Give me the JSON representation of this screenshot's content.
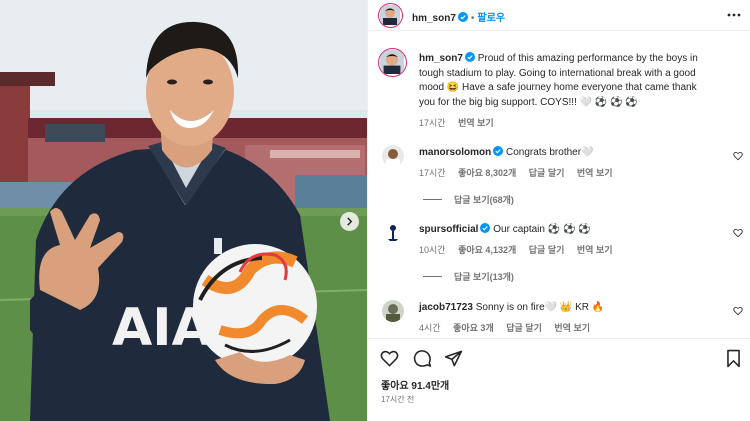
{
  "post": {
    "author": "hm_son7",
    "follow_label": "팔로우",
    "caption_lines": [
      "Proud of this amazing performance by the boys in",
      "tough stadium to play. Going to international break with a good",
      "mood 😆  Have a safe journey home everyone that came thank",
      "you for the big big support. COYS!!! 🤍 ⚽ ⚽ ⚽"
    ],
    "caption_time": "17시간",
    "translate_label": "번역 보기",
    "likes": "좋아요 91.4만개",
    "time": "17시간 전"
  },
  "comments": [
    {
      "user": "manorsolomon",
      "verified": true,
      "text": "Congrats brother🤍",
      "time": "17시간",
      "likes": "좋아요 8,302개",
      "reply_label": "답글 달기",
      "translate_label": "번역 보기",
      "replies": "답글 보기(68개)"
    },
    {
      "user": "spursofficial",
      "verified": true,
      "text": "Our captain ⚽ ⚽ ⚽",
      "time": "10시간",
      "likes": "좋아요 4,132개",
      "reply_label": "답글 달기",
      "translate_label": "번역 보기",
      "replies": "답글 보기(13개)"
    },
    {
      "user": "jacob71723",
      "verified": false,
      "text": "Sonny is on fire🤍 👑 KR 🔥",
      "time": "4시간",
      "likes": "좋아요 3개",
      "reply_label": "답글 달기",
      "translate_label": "번역 보기"
    }
  ],
  "photo": {
    "shirt_text": "AIA"
  },
  "icons": {
    "more": "more-horizontal-icon",
    "like": "heart-outline-icon",
    "comment": "comment-bubble-icon",
    "share": "paper-plane-icon",
    "save": "bookmark-icon",
    "verified": "verified-badge-icon",
    "next": "chevron-right-icon"
  },
  "colors": {
    "accent": "#0095f6",
    "muted": "#737373",
    "text": "#262626",
    "verified": "#0095f6",
    "ring": "#d62976"
  }
}
